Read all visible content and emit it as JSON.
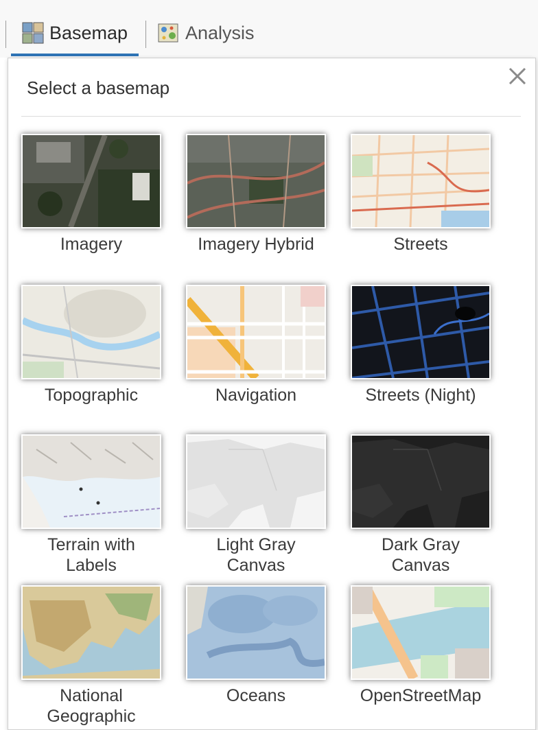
{
  "toolbar": {
    "tabs": [
      {
        "label": "Basemap",
        "icon": "basemap-grid-icon",
        "active": true
      },
      {
        "label": "Analysis",
        "icon": "analysis-map-icon",
        "active": false
      }
    ],
    "accent_color": "#2f74b5"
  },
  "popup": {
    "title": "Select a basemap",
    "close_icon": "close-icon"
  },
  "basemaps": [
    {
      "label": "Imagery"
    },
    {
      "label": "Imagery Hybrid"
    },
    {
      "label": "Streets"
    },
    {
      "label": "Topographic"
    },
    {
      "label": "Navigation"
    },
    {
      "label": "Streets (Night)"
    },
    {
      "label": "Terrain with Labels"
    },
    {
      "label": "Light Gray Canvas"
    },
    {
      "label": "Dark Gray Canvas"
    },
    {
      "label": "National Geographic"
    },
    {
      "label": "Oceans"
    },
    {
      "label": "OpenStreetMap"
    }
  ]
}
